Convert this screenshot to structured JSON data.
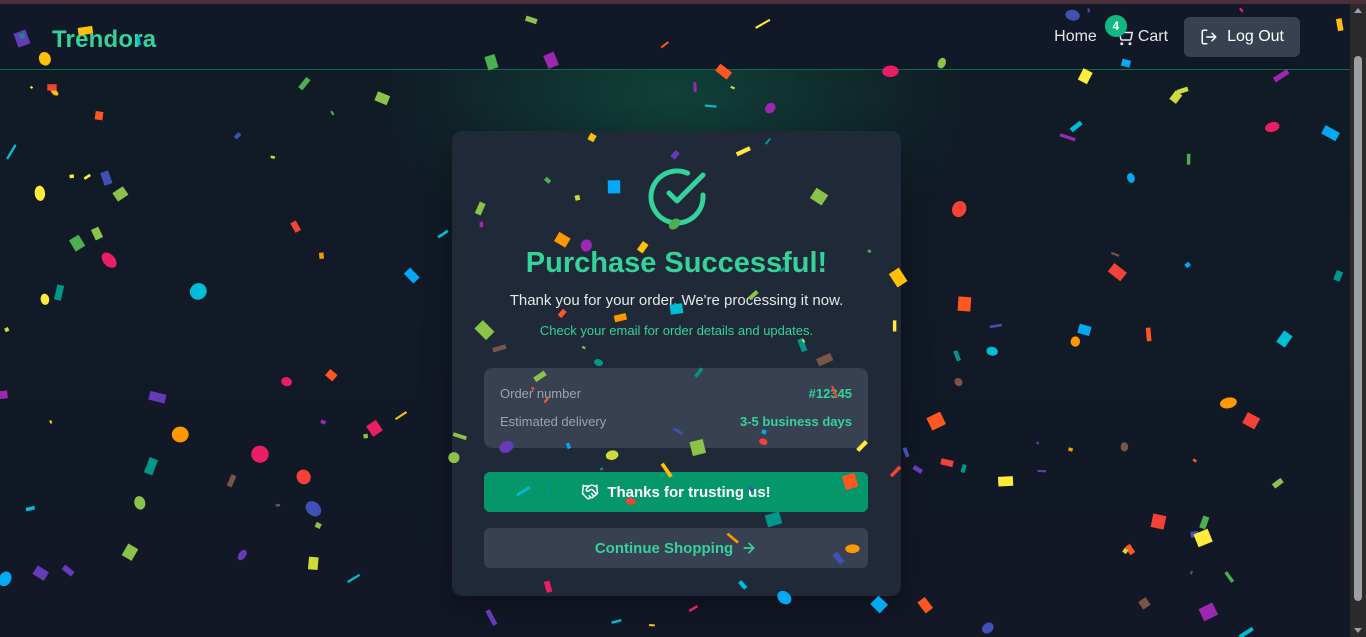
{
  "brand": "Trendora",
  "nav": {
    "home_label": "Home",
    "cart_label": "Cart",
    "cart_count": "4",
    "logout_label": "Log Out"
  },
  "success": {
    "title": "Purchase Successful!",
    "subtitle": "Thank you for your order. We're processing it now.",
    "note": "Check your email for order details and updates.",
    "order_number_label": "Order number",
    "order_number_value": "#12345",
    "delivery_label": "Estimated delivery",
    "delivery_value": "3-5 business days",
    "thanks_button": "Thanks for trusting us!",
    "continue_button": "Continue Shopping"
  },
  "icons": {
    "success": "check-circle-icon",
    "cart": "cart-icon",
    "logout": "logout-icon",
    "thanks": "handshake-icon",
    "continue": "arrow-right-icon"
  },
  "colors": {
    "accent": "#34d399",
    "primary_button": "#059669",
    "card": "#1f2937",
    "background": "#111827"
  }
}
